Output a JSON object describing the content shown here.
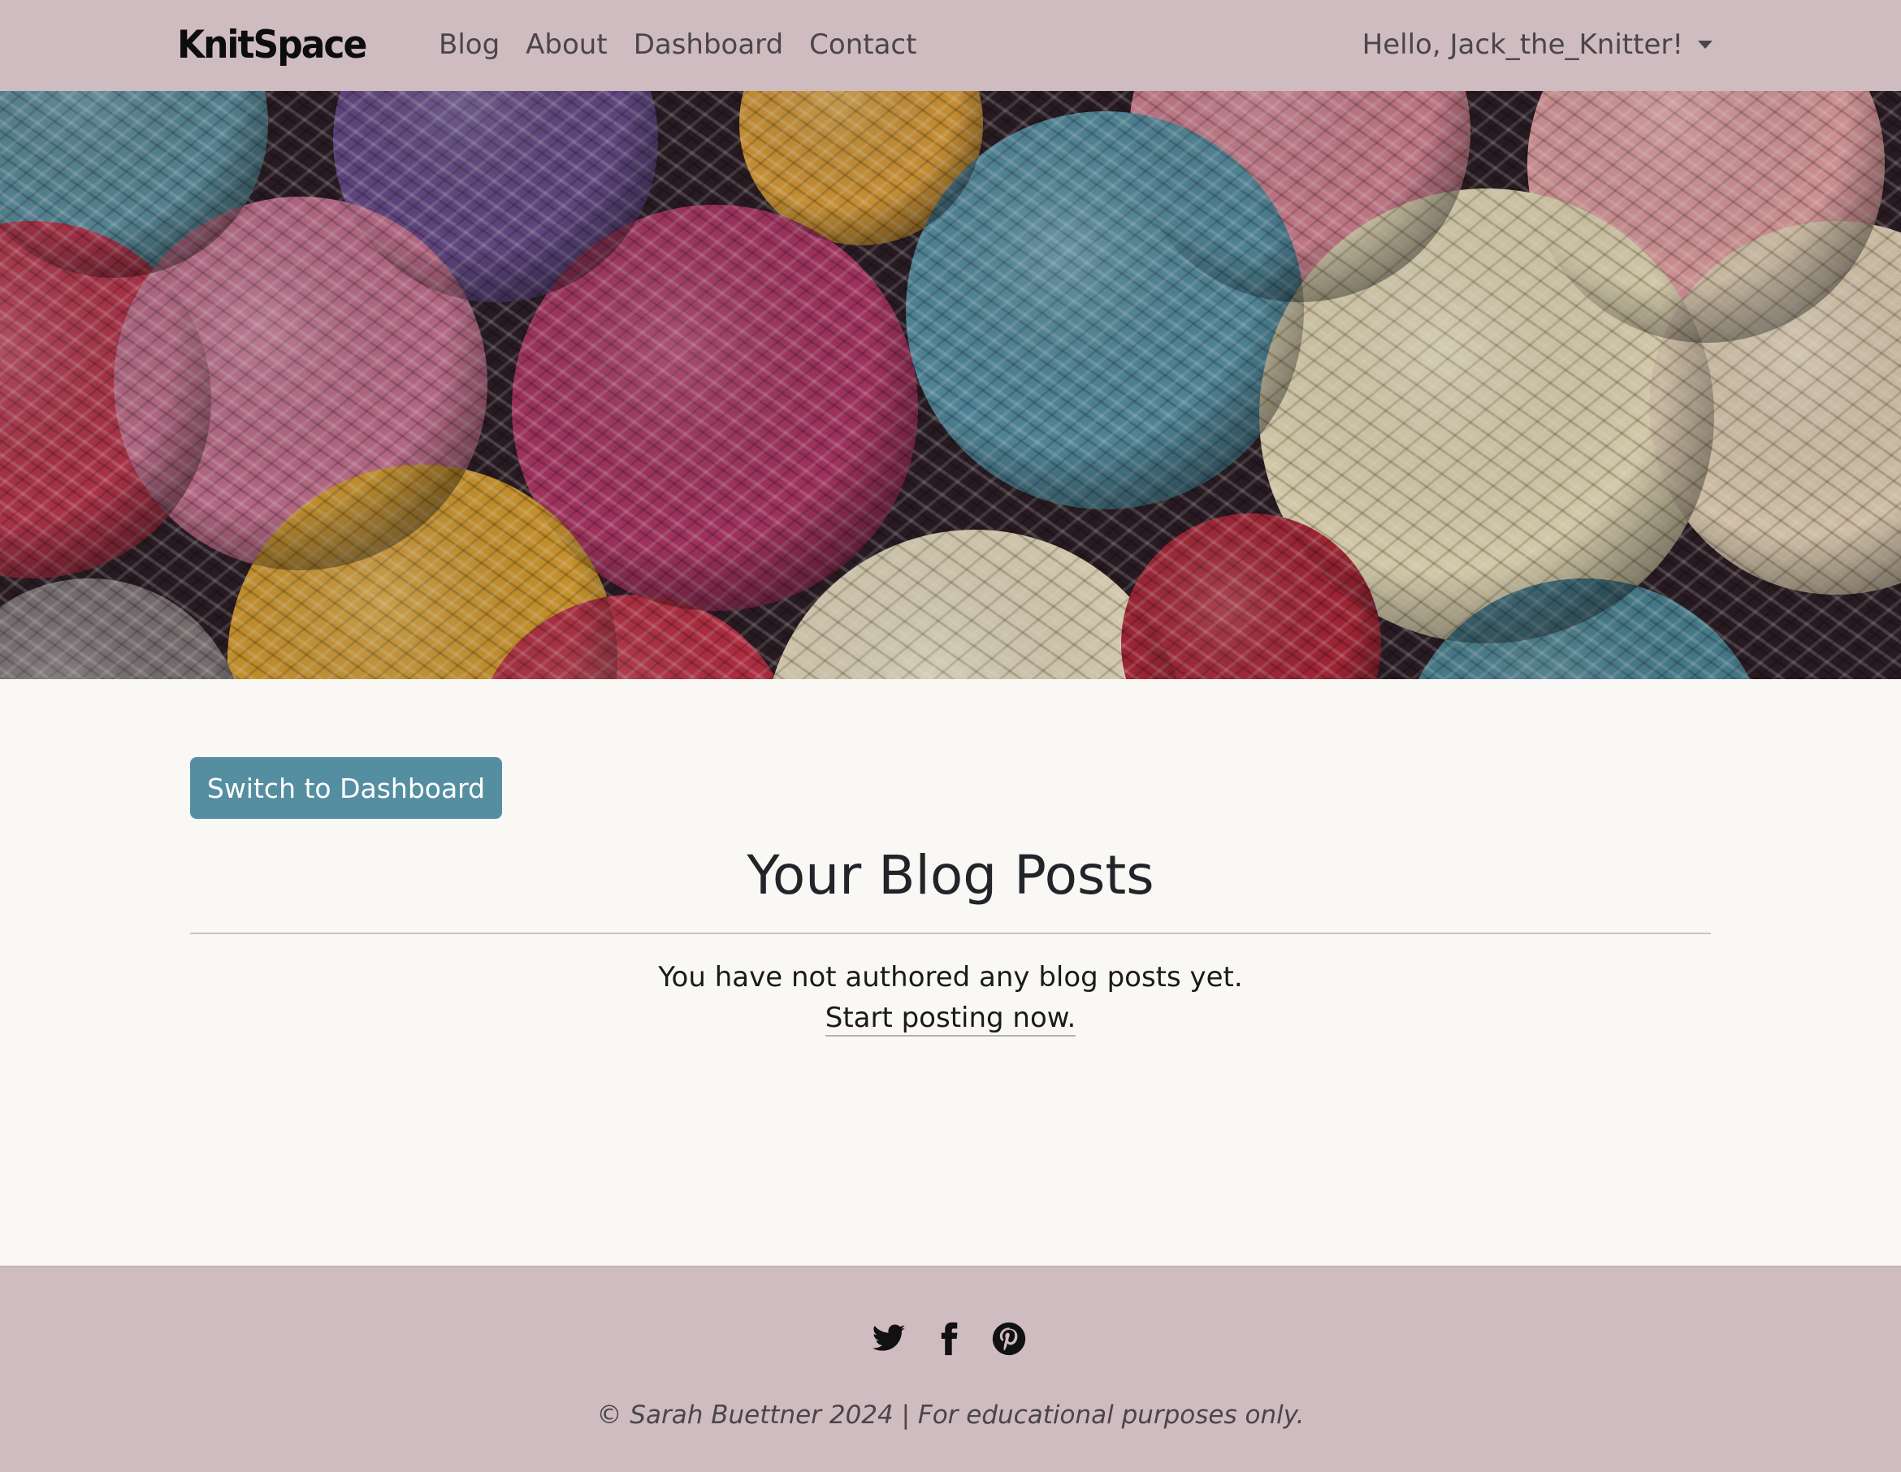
{
  "navbar": {
    "brand": "KnitSpace",
    "links": [
      {
        "label": "Blog"
      },
      {
        "label": "About"
      },
      {
        "label": "Dashboard"
      },
      {
        "label": "Contact"
      }
    ],
    "user_greeting": "Hello, Jack_the_Knitter!"
  },
  "hero": {
    "image": "yarn-balls-photo"
  },
  "main": {
    "switch_button": "Switch to Dashboard",
    "title": "Your Blog Posts",
    "empty_message": "You have not authored any blog posts yet.",
    "start_link": "Start posting now."
  },
  "footer": {
    "socials": [
      {
        "icon": "twitter-icon"
      },
      {
        "icon": "facebook-icon"
      },
      {
        "icon": "pinterest-icon"
      }
    ],
    "copyright": "© Sarah Buettner 2024 | For educational purposes only."
  },
  "colors": {
    "navbar_bg": "#cfbcc0",
    "page_bg": "#f9f8f5",
    "button_bg": "#558ea1"
  }
}
